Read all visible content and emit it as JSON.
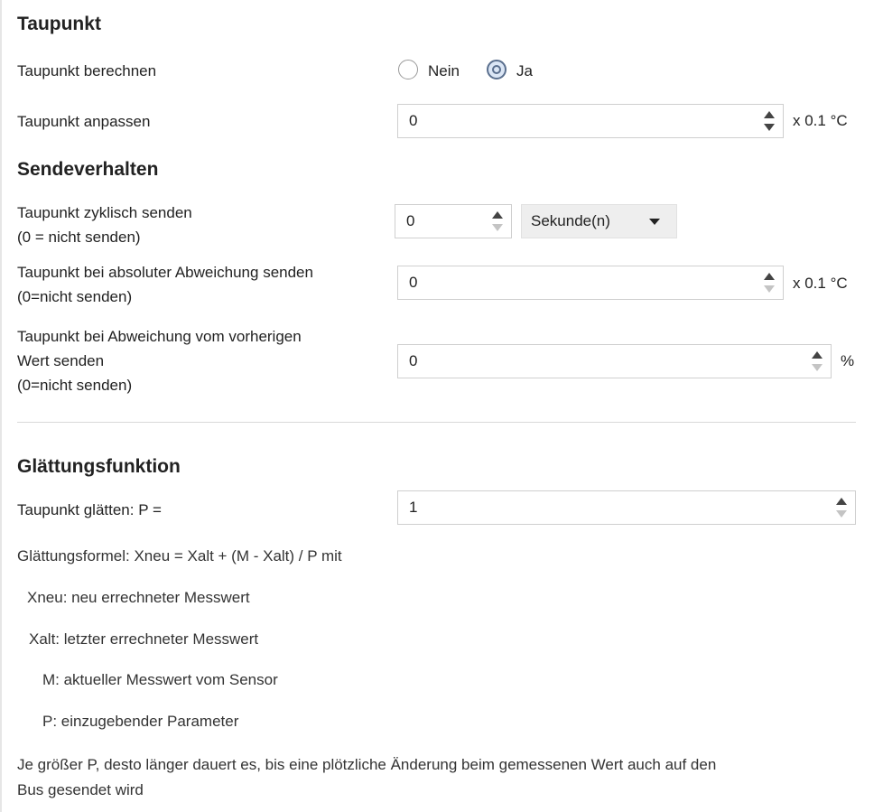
{
  "sections": {
    "taupunkt": "Taupunkt",
    "sendeverhalten": "Sendeverhalten",
    "glaettung": "Glättungsfunktion"
  },
  "fields": {
    "berechnen": {
      "label": "Taupunkt berechnen",
      "options": [
        "Nein",
        "Ja"
      ],
      "selected": "Ja"
    },
    "anpassen": {
      "label": "Taupunkt anpassen",
      "value": "0",
      "unit": "x 0.1 °C"
    },
    "zyklisch": {
      "label_line1": "Taupunkt zyklisch senden",
      "label_line2": "(0 = nicht senden)",
      "value": "0",
      "select_value": "Sekunde(n)"
    },
    "absolut": {
      "label_line1": "Taupunkt bei absoluter Abweichung senden",
      "label_line2": "(0=nicht senden)",
      "value": "0",
      "unit": "x 0.1 °C"
    },
    "vorherig": {
      "label_line1": "Taupunkt bei Abweichung vom vorherigen",
      "label_line2": "Wert senden",
      "label_line3": "(0=nicht senden)",
      "value": "0",
      "unit": "%"
    },
    "glaetten": {
      "label": "Taupunkt glätten: P =",
      "value": "1"
    }
  },
  "info": {
    "formula": "Glättungsformel: Xneu = Xalt + (M - Xalt) / P mit",
    "xneu": "Xneu: neu errechneter Messwert",
    "xalt": "Xalt: letzter errechneter Messwert",
    "m": "M: aktueller Messwert vom Sensor",
    "p": "P: einzugebender Parameter",
    "note_line1": "Je größer P, desto länger dauert es, bis eine plötzliche Änderung beim gemessenen Wert auch auf den",
    "note_line2": "Bus gesendet wird"
  }
}
